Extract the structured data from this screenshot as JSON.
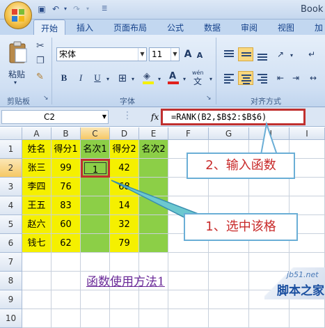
{
  "title_bar": {
    "title": "Book"
  },
  "tabs": [
    "开始",
    "插入",
    "页面布局",
    "公式",
    "数据",
    "审阅",
    "视图",
    "加"
  ],
  "ribbon": {
    "paste_label": "粘贴",
    "clipboard_label": "剪贴板",
    "font_name": "宋体",
    "font_size": "11",
    "bold": "B",
    "italic": "I",
    "underline": "U",
    "font_group_label": "字体",
    "align_group_label": "对齐方式",
    "grow_font": "A",
    "shrink_font": "A",
    "font_color_glyph": "A",
    "wen_glyph": "wén"
  },
  "formula_bar": {
    "name_box": "C2",
    "fx_label": "fx",
    "formula": "=RANK(B2,$B$2:$B$6)"
  },
  "grid": {
    "columns": [
      "A",
      "B",
      "C",
      "D",
      "E",
      "F",
      "G",
      "H",
      "I"
    ],
    "rows": [
      "1",
      "2",
      "3",
      "4",
      "5",
      "6",
      "7",
      "8",
      "9",
      "10"
    ],
    "headers": [
      "姓名",
      "得分1",
      "名次1",
      "得分2",
      "名次2"
    ],
    "data": [
      [
        "张三",
        "99",
        "1",
        "42",
        ""
      ],
      [
        "李四",
        "76",
        "",
        "68",
        ""
      ],
      [
        "王五",
        "83",
        "",
        "14",
        ""
      ],
      [
        "赵六",
        "60",
        "",
        "32",
        ""
      ],
      [
        "钱七",
        "62",
        "",
        "79",
        ""
      ]
    ]
  },
  "callouts": {
    "step2": "2、输入函数",
    "step1": "1、选中该格"
  },
  "footer": "函数使用方法1",
  "watermark": {
    "site": "jb51.net",
    "name": "脚本之家"
  },
  "colors": {
    "yellow": "#f5f000",
    "green": "#8ccf47",
    "highlight_red": "#c0302f",
    "callout_blue": "#6aaed6"
  }
}
